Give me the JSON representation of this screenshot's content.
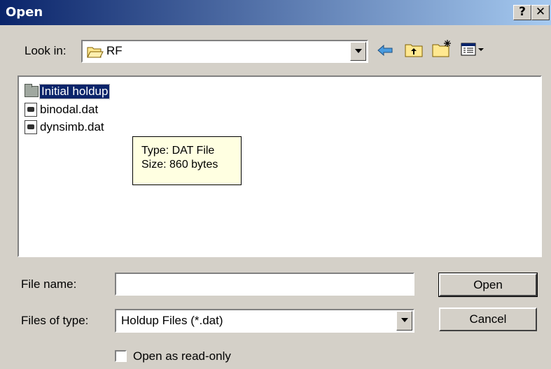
{
  "window": {
    "title": "Open",
    "help_label": "?",
    "close_label": "✕"
  },
  "lookin": {
    "label": "Look in:",
    "value": "RF"
  },
  "toolbar": {
    "back_icon": "back-arrow-icon",
    "up_icon": "up-folder-icon",
    "new_folder_icon": "new-folder-icon",
    "view_menu_icon": "view-menu-icon"
  },
  "files": [
    {
      "name": "Initial holdup",
      "type": "folder"
    },
    {
      "name": "binodal.dat",
      "type": "file"
    },
    {
      "name": "dynsimb.dat",
      "type": "file"
    }
  ],
  "tooltip": {
    "line1": "Type: DAT File",
    "line2": "Size: 860 bytes"
  },
  "filename": {
    "label": "File name:",
    "value": ""
  },
  "filetype": {
    "label": "Files of type:",
    "value": "Holdup Files (*.dat)"
  },
  "buttons": {
    "open": "Open",
    "cancel": "Cancel"
  },
  "readonly": {
    "label": "Open as read-only",
    "checked": false
  },
  "colors": {
    "titlebar_start": "#0a246a",
    "titlebar_end": "#a6caf0",
    "face": "#d4d0c8",
    "tooltip_bg": "#ffffe1"
  }
}
